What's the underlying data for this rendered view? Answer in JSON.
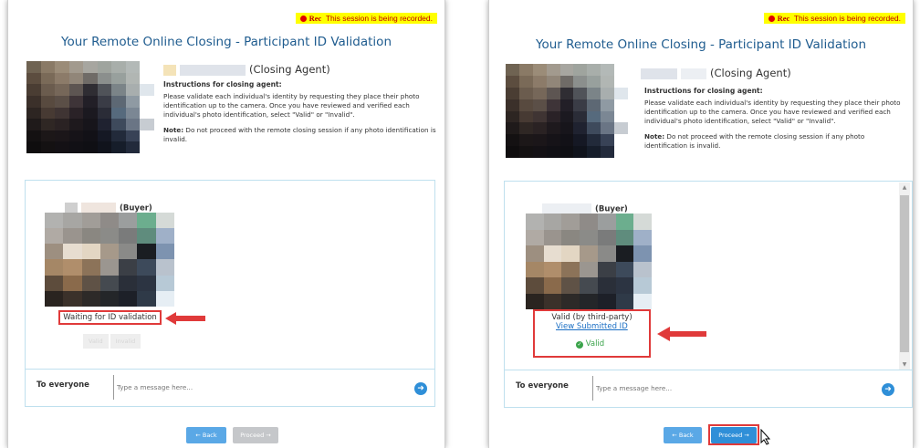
{
  "recording": {
    "rec_label": "Rec",
    "message": "This session is being recorded."
  },
  "page": {
    "title": "Your Remote Online Closing - Participant ID Validation"
  },
  "agent": {
    "role": "(Closing Agent)"
  },
  "instructions": {
    "heading": "Instructions for closing agent:",
    "body": "Please validate each individual's identity by requesting they place their photo identification up to the camera. Once you have reviewed and verified each individual's photo identification, select \"Valid\" or \"Invalid\".",
    "note_label": "Note:",
    "note_text": " Do not proceed with the remote closing session if any photo identification is invalid."
  },
  "buyer": {
    "role": "(Buyer)"
  },
  "left": {
    "status": "Waiting for ID validation",
    "valid_label": "Valid",
    "invalid_label": "Invalid"
  },
  "right": {
    "status": "Valid (by third-party)",
    "view_link": "View Submitted ID",
    "valid_badge": "Valid"
  },
  "chat": {
    "to_label": "To everyone",
    "placeholder": "Type a message here..."
  },
  "buttons": {
    "back": "← Back",
    "proceed": "Proceed →"
  },
  "colors": {
    "title": "#1f5c8f",
    "highlight": "#e03a3a",
    "primary": "#2f8fd8",
    "rec_bg": "#ffff00"
  },
  "icons": [
    "record-dot-icon",
    "send-arrow-icon",
    "check-circle-icon",
    "red-arrow-icon",
    "mouse-pointer-icon",
    "scroll-up-icon",
    "scroll-down-icon"
  ]
}
